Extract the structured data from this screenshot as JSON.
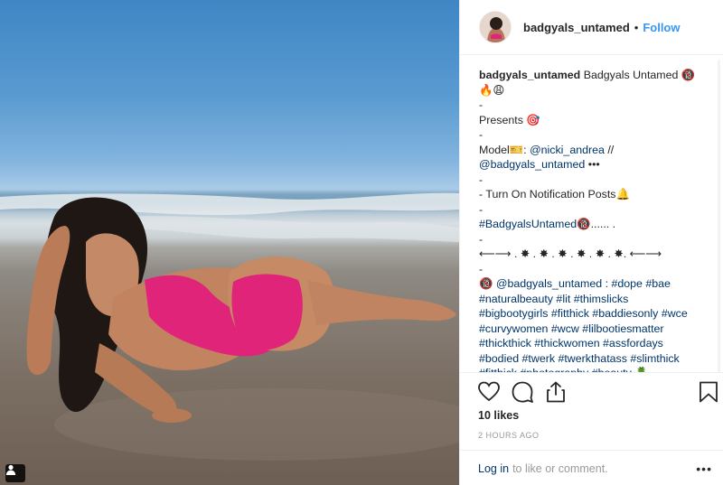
{
  "post": {
    "username": "badgyals_untamed",
    "follow_label": "Follow",
    "header_separator": "•"
  },
  "caption": {
    "lines": [
      {
        "user": "badgyals_untamed",
        "text": " Badgyals Untamed 🔞"
      },
      {
        "text": "🔥😩"
      },
      {
        "text": "-"
      },
      {
        "text": "Presents 🎯"
      },
      {
        "text": "-"
      },
      {
        "pre": "Model🎫: ",
        "link": "@nicki_andrea",
        "post": " //"
      },
      {
        "link": "@badgyals_untamed",
        "post": " •••"
      },
      {
        "text": "-"
      },
      {
        "text": "-  Turn On Notification Posts🔔"
      },
      {
        "text": "-"
      },
      {
        "link": "#BadgyalsUntamed🔞",
        "post": "...... ."
      },
      {
        "text": "-"
      },
      {
        "text": "⟵⟶ . ✸ . ✸ . ✸ . ✸ . ✸ . ✸. ⟵⟶"
      },
      {
        "text": "-"
      },
      {
        "pre": "🔞 ",
        "link": "@badgyals_untamed : #dope #bae"
      },
      {
        "link": "#naturalbeauty #lit #thimslicks"
      },
      {
        "link": "#bigbootygirls #fitthick #baddiesonly #wce"
      },
      {
        "link": "#curvywomen #wcw #lilbootiesmatter"
      },
      {
        "link": "#thickthick #thickwomen #assfordays"
      },
      {
        "link": "#bodied #twerk #twerkthatass #slimthick"
      },
      {
        "link": "#fitthick #photography #beauty 🍍"
      }
    ]
  },
  "actions": {
    "likes": "10 likes",
    "time": "2 HOURS AGO",
    "login_label": "Log in",
    "comment_prompt": "to like or comment.",
    "more_label": "•••"
  },
  "icons": {
    "like": "heart-icon",
    "comment": "comment-icon",
    "share": "share-icon",
    "save": "bookmark-icon",
    "tagged": "user-tag-icon"
  },
  "colors": {
    "follow": "#3897f0",
    "link": "#003569",
    "muted": "#999999",
    "swimsuit": "#e0247a"
  }
}
